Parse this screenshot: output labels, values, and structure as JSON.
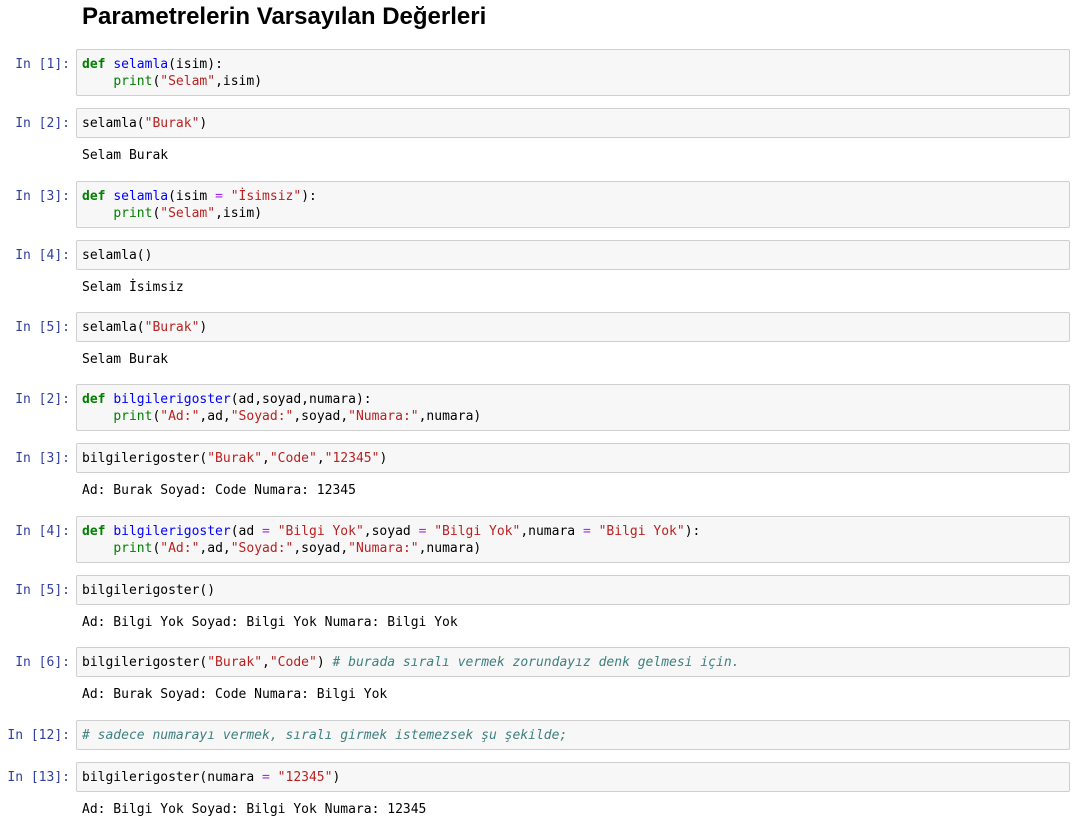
{
  "notebook": {
    "heading": "Parametrelerin Varsayılan Değerleri",
    "cells": [
      {
        "prompt": "In [1]:",
        "lines": [
          [
            {
              "t": "kw",
              "v": "def"
            },
            {
              "t": "p",
              "v": " "
            },
            {
              "t": "fn",
              "v": "selamla"
            },
            {
              "t": "p",
              "v": "(isim):"
            }
          ],
          [
            {
              "t": "p",
              "v": "    "
            },
            {
              "t": "bi",
              "v": "print"
            },
            {
              "t": "p",
              "v": "("
            },
            {
              "t": "st",
              "v": "\"Selam\""
            },
            {
              "t": "p",
              "v": ",isim)"
            }
          ]
        ],
        "output": null
      },
      {
        "prompt": "In [2]:",
        "lines": [
          [
            {
              "t": "p",
              "v": "selamla("
            },
            {
              "t": "st",
              "v": "\"Burak\""
            },
            {
              "t": "p",
              "v": ")"
            }
          ]
        ],
        "output": "Selam Burak"
      },
      {
        "prompt": "In [3]:",
        "lines": [
          [
            {
              "t": "kw",
              "v": "def"
            },
            {
              "t": "p",
              "v": " "
            },
            {
              "t": "fn",
              "v": "selamla"
            },
            {
              "t": "p",
              "v": "(isim "
            },
            {
              "t": "op",
              "v": "="
            },
            {
              "t": "p",
              "v": " "
            },
            {
              "t": "st",
              "v": "\"İsimsiz\""
            },
            {
              "t": "p",
              "v": "):"
            }
          ],
          [
            {
              "t": "p",
              "v": "    "
            },
            {
              "t": "bi",
              "v": "print"
            },
            {
              "t": "p",
              "v": "("
            },
            {
              "t": "st",
              "v": "\"Selam\""
            },
            {
              "t": "p",
              "v": ",isim)"
            }
          ]
        ],
        "output": null
      },
      {
        "prompt": "In [4]:",
        "lines": [
          [
            {
              "t": "p",
              "v": "selamla()"
            }
          ]
        ],
        "output": "Selam İsimsiz"
      },
      {
        "prompt": "In [5]:",
        "lines": [
          [
            {
              "t": "p",
              "v": "selamla("
            },
            {
              "t": "st",
              "v": "\"Burak\""
            },
            {
              "t": "p",
              "v": ")"
            }
          ]
        ],
        "output": "Selam Burak"
      },
      {
        "prompt": "In [2]:",
        "lines": [
          [
            {
              "t": "kw",
              "v": "def"
            },
            {
              "t": "p",
              "v": " "
            },
            {
              "t": "fn",
              "v": "bilgilerigoster"
            },
            {
              "t": "p",
              "v": "(ad,soyad,numara):"
            }
          ],
          [
            {
              "t": "p",
              "v": "    "
            },
            {
              "t": "bi",
              "v": "print"
            },
            {
              "t": "p",
              "v": "("
            },
            {
              "t": "st",
              "v": "\"Ad:\""
            },
            {
              "t": "p",
              "v": ",ad,"
            },
            {
              "t": "st",
              "v": "\"Soyad:\""
            },
            {
              "t": "p",
              "v": ",soyad,"
            },
            {
              "t": "st",
              "v": "\"Numara:\""
            },
            {
              "t": "p",
              "v": ",numara)"
            }
          ]
        ],
        "output": null
      },
      {
        "prompt": "In [3]:",
        "lines": [
          [
            {
              "t": "p",
              "v": "bilgilerigoster("
            },
            {
              "t": "st",
              "v": "\"Burak\""
            },
            {
              "t": "p",
              "v": ","
            },
            {
              "t": "st",
              "v": "\"Code\""
            },
            {
              "t": "p",
              "v": ","
            },
            {
              "t": "st",
              "v": "\"12345\""
            },
            {
              "t": "p",
              "v": ")"
            }
          ]
        ],
        "output": "Ad: Burak Soyad: Code Numara: 12345"
      },
      {
        "prompt": "In [4]:",
        "lines": [
          [
            {
              "t": "kw",
              "v": "def"
            },
            {
              "t": "p",
              "v": " "
            },
            {
              "t": "fn",
              "v": "bilgilerigoster"
            },
            {
              "t": "p",
              "v": "(ad "
            },
            {
              "t": "op",
              "v": "="
            },
            {
              "t": "p",
              "v": " "
            },
            {
              "t": "st",
              "v": "\"Bilgi Yok\""
            },
            {
              "t": "p",
              "v": ",soyad "
            },
            {
              "t": "op",
              "v": "="
            },
            {
              "t": "p",
              "v": " "
            },
            {
              "t": "st",
              "v": "\"Bilgi Yok\""
            },
            {
              "t": "p",
              "v": ",numara "
            },
            {
              "t": "op",
              "v": "="
            },
            {
              "t": "p",
              "v": " "
            },
            {
              "t": "st",
              "v": "\"Bilgi Yok\""
            },
            {
              "t": "p",
              "v": "):"
            }
          ],
          [
            {
              "t": "p",
              "v": "    "
            },
            {
              "t": "bi",
              "v": "print"
            },
            {
              "t": "p",
              "v": "("
            },
            {
              "t": "st",
              "v": "\"Ad:\""
            },
            {
              "t": "p",
              "v": ",ad,"
            },
            {
              "t": "st",
              "v": "\"Soyad:\""
            },
            {
              "t": "p",
              "v": ",soyad,"
            },
            {
              "t": "st",
              "v": "\"Numara:\""
            },
            {
              "t": "p",
              "v": ",numara)"
            }
          ]
        ],
        "output": null
      },
      {
        "prompt": "In [5]:",
        "lines": [
          [
            {
              "t": "p",
              "v": "bilgilerigoster()"
            }
          ]
        ],
        "output": "Ad: Bilgi Yok Soyad: Bilgi Yok Numara: Bilgi Yok"
      },
      {
        "prompt": "In [6]:",
        "lines": [
          [
            {
              "t": "p",
              "v": "bilgilerigoster("
            },
            {
              "t": "st",
              "v": "\"Burak\""
            },
            {
              "t": "p",
              "v": ","
            },
            {
              "t": "st",
              "v": "\"Code\""
            },
            {
              "t": "p",
              "v": ") "
            },
            {
              "t": "cm",
              "v": "# burada sıralı vermek zorundayız denk gelmesi için."
            }
          ]
        ],
        "output": "Ad: Burak Soyad: Code Numara: Bilgi Yok"
      },
      {
        "prompt": "In [12]:",
        "lines": [
          [
            {
              "t": "cm",
              "v": "# sadece numarayı vermek, sıralı girmek istemezsek şu şekilde;"
            }
          ]
        ],
        "output": null
      },
      {
        "prompt": "In [13]:",
        "lines": [
          [
            {
              "t": "p",
              "v": "bilgilerigoster(numara "
            },
            {
              "t": "op",
              "v": "="
            },
            {
              "t": "p",
              "v": " "
            },
            {
              "t": "st",
              "v": "\"12345\""
            },
            {
              "t": "p",
              "v": ")"
            }
          ]
        ],
        "output": "Ad: Bilgi Yok Soyad: Bilgi Yok Numara: 12345"
      }
    ]
  },
  "syntax_colors": {
    "keyword": "#008000",
    "function_name": "#0000ff",
    "builtin": "#008000",
    "string": "#ba2121",
    "operator": "#aa22ff",
    "comment": "#408080",
    "prompt": "#303f9f",
    "input_background": "#f7f7f7",
    "input_border": "#cfcfcf"
  }
}
